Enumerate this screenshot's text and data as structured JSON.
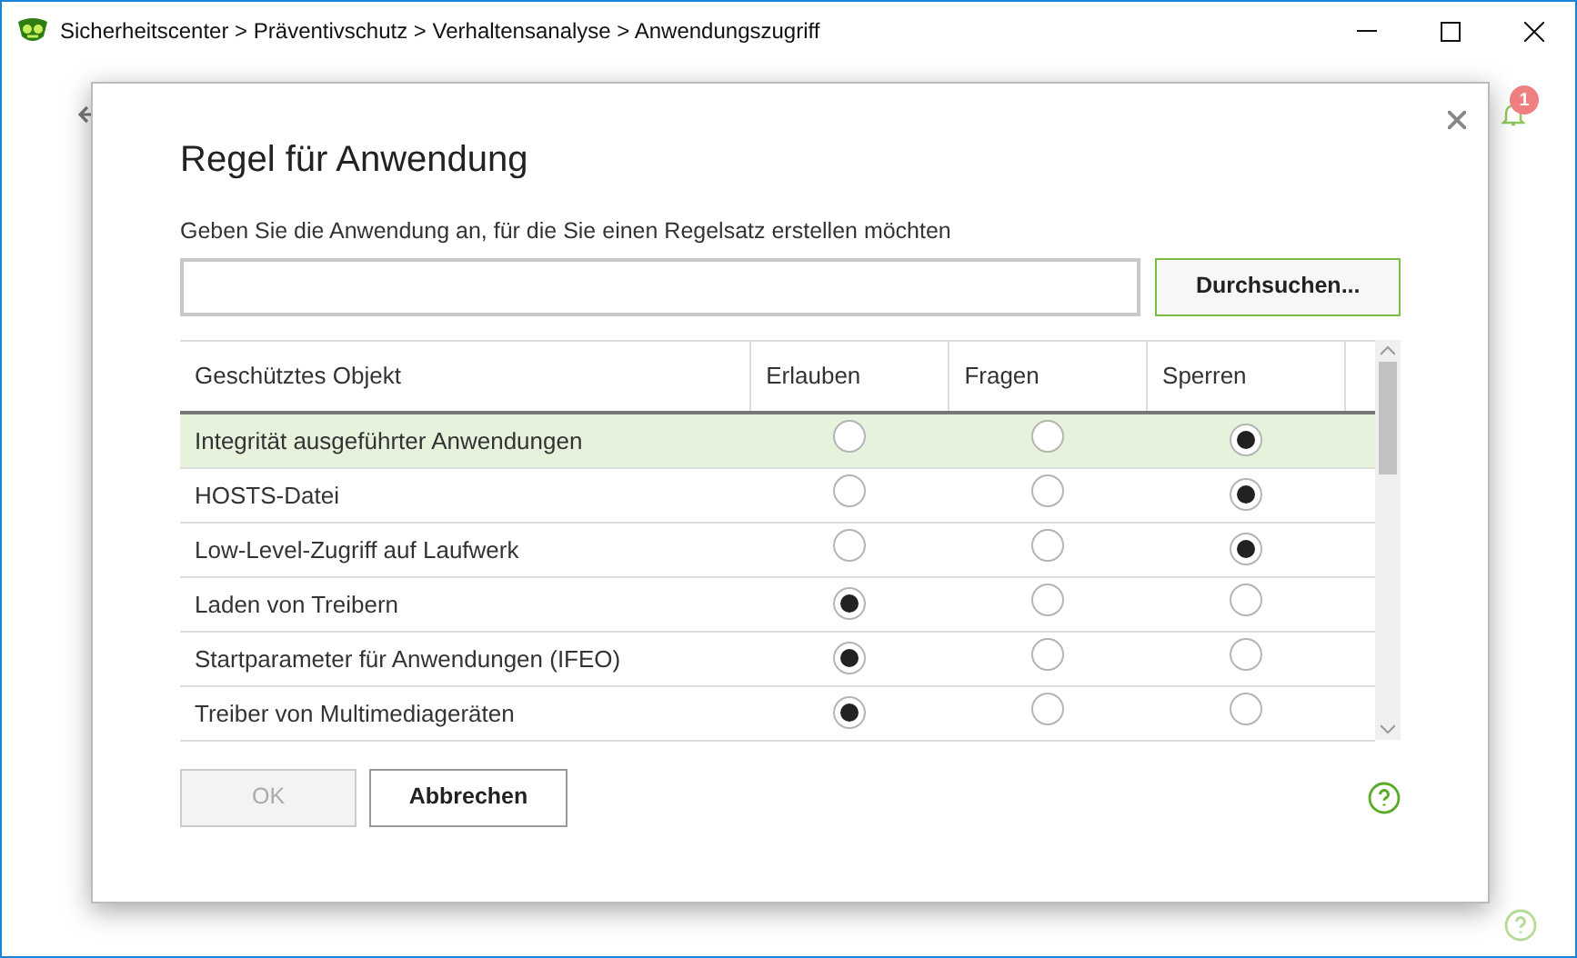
{
  "window": {
    "title": "Sicherheitscenter > Präventivschutz > Verhaltensanalyse > Anwendungszugriff"
  },
  "notifications": {
    "count": "1"
  },
  "dialog": {
    "title": "Regel für Anwendung",
    "prompt": "Geben Sie die Anwendung an, für die Sie einen Regelsatz erstellen möchten",
    "browse_button": "Durchsuchen...",
    "table": {
      "columns": [
        "Geschütztes Objekt",
        "Erlauben",
        "Fragen",
        "Sperren"
      ],
      "rows": [
        {
          "object": "Integrität ausgeführter Anwendungen",
          "allow": false,
          "ask": false,
          "block": true,
          "selected": true
        },
        {
          "object": "HOSTS-Datei",
          "allow": false,
          "ask": false,
          "block": true,
          "selected": false
        },
        {
          "object": "Low-Level-Zugriff auf Laufwerk",
          "allow": false,
          "ask": false,
          "block": true,
          "selected": false
        },
        {
          "object": "Laden von Treibern",
          "allow": true,
          "ask": false,
          "block": false,
          "selected": false
        },
        {
          "object": "Startparameter für Anwendungen (IFEO)",
          "allow": true,
          "ask": false,
          "block": false,
          "selected": false
        },
        {
          "object": "Treiber von Multimediageräten",
          "allow": true,
          "ask": false,
          "block": false,
          "selected": false
        }
      ]
    },
    "buttons": [
      {
        "label": "OK",
        "disabled": true
      },
      {
        "label": "Abbrechen",
        "disabled": false
      }
    ]
  }
}
